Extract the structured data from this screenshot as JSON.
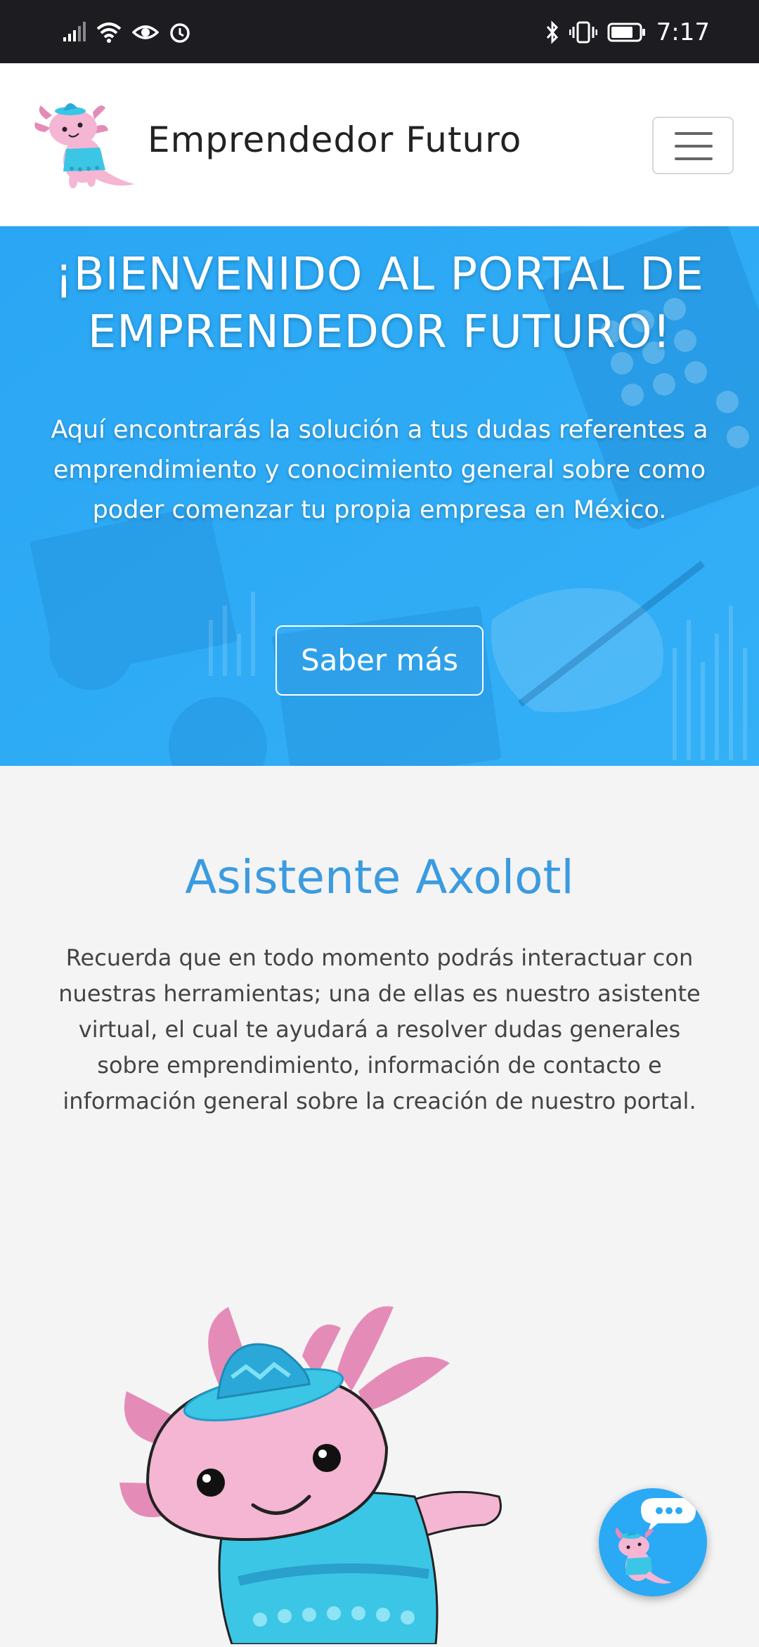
{
  "status_bar": {
    "time": "7:17",
    "left_icons": [
      "signal-icon",
      "wifi-icon",
      "eye-icon",
      "alarm-icon"
    ],
    "right_icons": [
      "bluetooth-icon",
      "vibrate-icon",
      "battery-icon"
    ]
  },
  "navbar": {
    "brand": "Emprendedor Futuro",
    "menu_icon": "hamburger-menu-icon"
  },
  "hero": {
    "title": "¡BIENVENIDO AL PORTAL DE EMPRENDEDOR FUTURO!",
    "text": "Aquí encontrarás la solución a tus dudas referentes a emprendimiento y conocimiento general sobre como poder comenzar tu propia empresa en México.",
    "button": "Saber más"
  },
  "assistant": {
    "title": "Asistente Axolotl",
    "text": "Recuerda que en todo momento podrás interactuar con nuestras herramientas; una de ellas es nuestro asistente virtual, el cual te ayudará a resolver dudas generales sobre emprendimiento, información de contacto e información general sobre la creación de nuestro portal."
  },
  "colors": {
    "hero_bg": "#2aa9f5",
    "accent_title": "#3b9be0",
    "axolotl_pink": "#f4b6d2",
    "sombrero_blue": "#3bc6e6"
  }
}
